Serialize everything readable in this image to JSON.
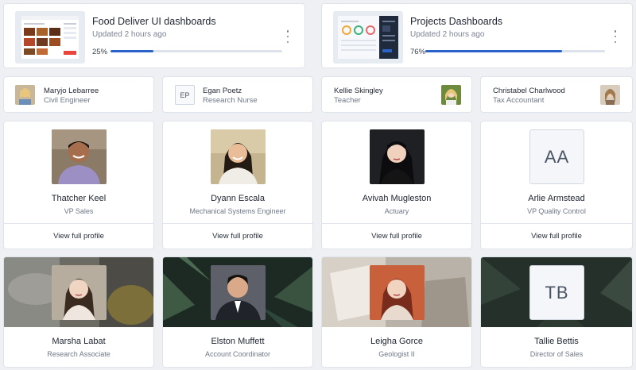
{
  "projects": [
    {
      "title": "Food Deliver UI dashboards",
      "updated": "Updated 2 hours ago",
      "progress_label": "25%",
      "progress": 0.25
    },
    {
      "title": "Projects Dashboards",
      "updated": "Updated 2 hours ago",
      "progress_label": "76%",
      "progress": 0.76
    }
  ],
  "contacts": [
    {
      "name": "Maryjo Lebarree",
      "role": "Civil Engineer"
    },
    {
      "name": "Egan Poetz",
      "role": "Research Nurse",
      "initials": "EP"
    },
    {
      "name": "Kellie Skingley",
      "role": "Teacher"
    },
    {
      "name": "Christabel Charlwood",
      "role": "Tax Accountant"
    }
  ],
  "profiles": [
    {
      "name": "Thatcher Keel",
      "role": "VP Sales",
      "link": "View full profile"
    },
    {
      "name": "Dyann Escala",
      "role": "Mechanical Systems Engineer",
      "link": "View full profile"
    },
    {
      "name": "Avivah Mugleston",
      "role": "Actuary",
      "link": "View full profile"
    },
    {
      "name": "Arlie Armstead",
      "role": "VP Quality Control",
      "link": "View full profile",
      "initials": "AA"
    }
  ],
  "cover_profiles": [
    {
      "name": "Marsha Labat",
      "role": "Research Associate"
    },
    {
      "name": "Elston Muffett",
      "role": "Account Coordinator"
    },
    {
      "name": "Leigha Gorce",
      "role": "Geologist II"
    },
    {
      "name": "Tallie Bettis",
      "role": "Director of Sales",
      "initials": "TB"
    }
  ],
  "colors": {
    "accent": "#2962c9",
    "border": "#dfe3ea",
    "background": "#eef0f4"
  }
}
